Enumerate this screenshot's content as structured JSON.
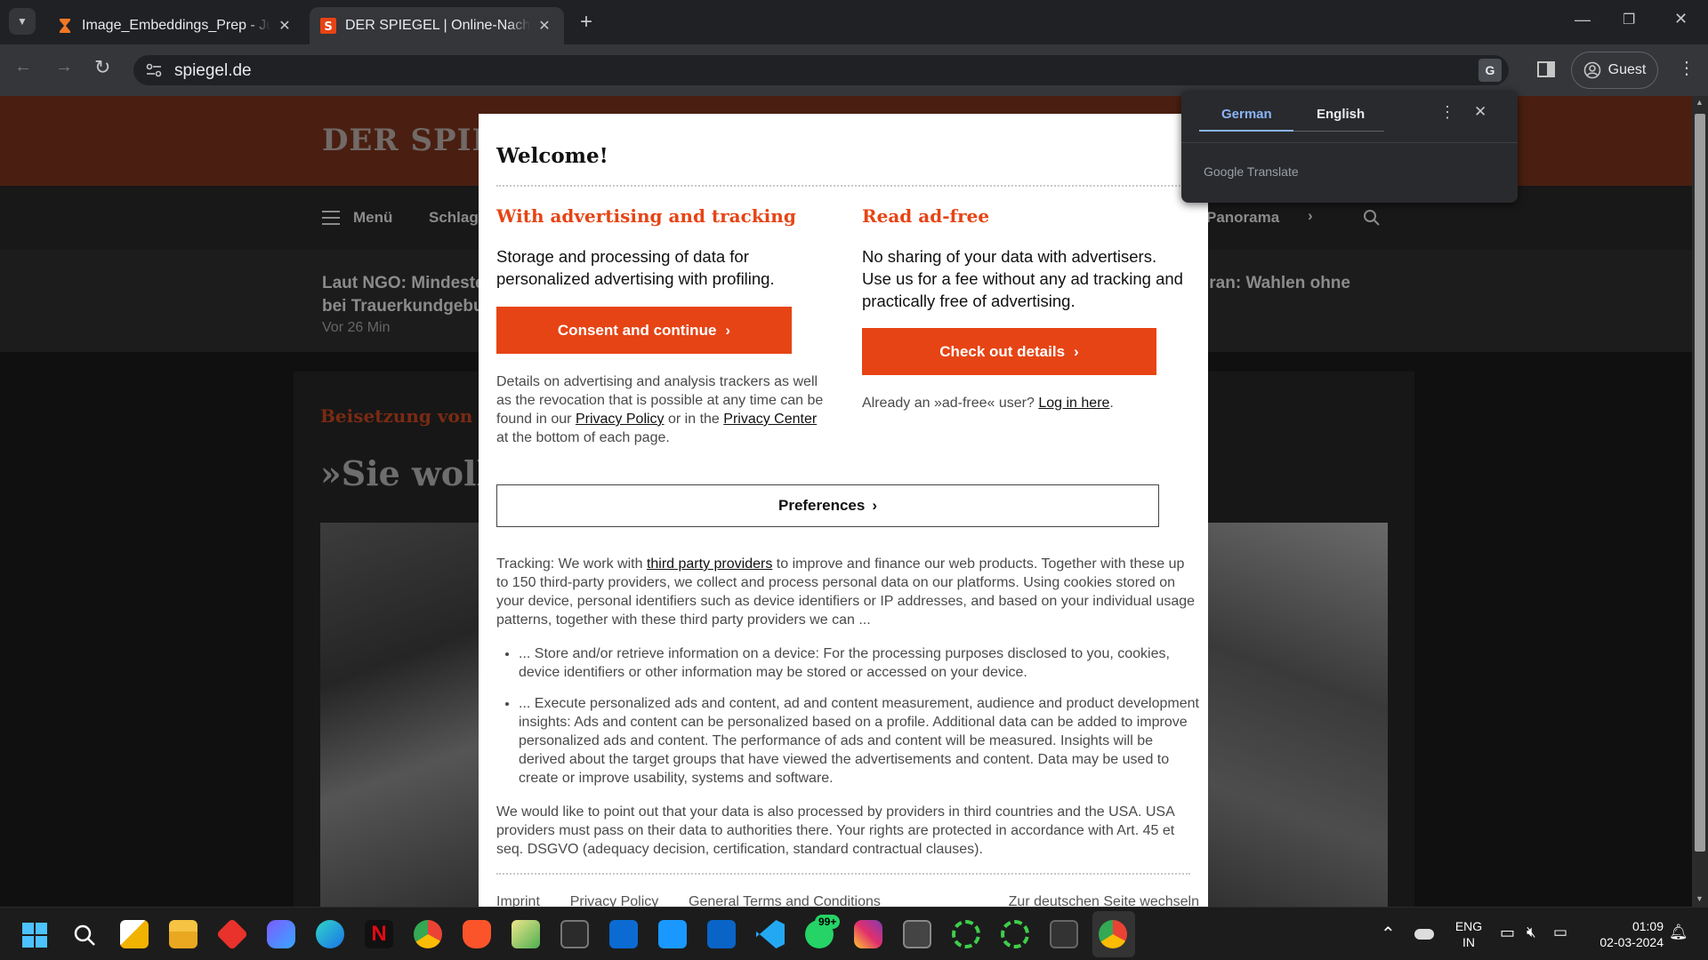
{
  "browser": {
    "tabs": [
      {
        "title": "Image_Embeddings_Prep - Jupyter",
        "active": false
      },
      {
        "title": "DER SPIEGEL | Online-Nachrichten",
        "active": true
      }
    ],
    "url": "spiegel.de",
    "profile": "Guest",
    "icons": [
      "back-icon",
      "forward-icon",
      "reload-icon",
      "site-info-icon",
      "translate-icon",
      "sidepanel-icon",
      "menu-icon"
    ]
  },
  "page": {
    "logo": "DER SPIEGEL",
    "nav": {
      "menu": "Menü",
      "item1": "Schlagzeilen",
      "item_right": "Panorama"
    },
    "ticker_left_1": "Laut NGO: Mindeste",
    "ticker_left_2": "bei Trauerkundgebu",
    "ticker_time": "Vor 26 Min",
    "ticker_right": "Iran: Wahlen ohne",
    "kicker": "Beisetzung von Kr",
    "headline": "»Sie wolle"
  },
  "modal": {
    "title": "Welcome!",
    "left": {
      "heading": "With advertising and tracking",
      "text": "Storage and processing of data for personalized advertising with profiling.",
      "button": "Consent and continue",
      "details_1": "Details on advertising and analysis trackers as well as the revocation that is possible at any time can be found in our",
      "privacy_policy": "Privacy Policy",
      "details_2": "or in the",
      "privacy_center": "Privacy Center",
      "details_3": "at the bottom of each page."
    },
    "right": {
      "heading": "Read ad-free",
      "text": "No sharing of your data with advertisers. Use us for a fee without any ad tracking and practically free of advertising.",
      "button": "Check out details",
      "already": "Already an »ad-free« user?",
      "login": "Log in here",
      "period": "."
    },
    "preferences": "Preferences",
    "tracking_1": "Tracking: We work with",
    "third_party": "third party providers",
    "tracking_2": "to improve and finance our web products. Together with these up to 150 third-party providers, we collect and process personal data on our platforms. Using cookies stored on your device, personal identifiers such as device identifiers or IP addresses, and based on your individual usage patterns, together with these third party providers we can ...",
    "bullets": [
      "... Store and/or retrieve information on a device: For the processing purposes disclosed to you, cookies, device identifiers or other information may be stored or accessed on your device.",
      "... Execute personalized ads and content, ad and content measurement, audience and product development insights: Ads and content can be personalized based on a profile. Additional data can be added to improve personalized ads and content. The performance of ads and content will be measured. Insights will be derived about the target groups that have viewed the advertisements and content. Data may be used to create or improve usability, systems and software."
    ],
    "third_countries": "We would like to point out that your data is also processed by providers in third countries and the USA. USA providers must pass on their data to authorities there. Your rights are protected in accordance with Art. 45 et seq. DSGVO (adequacy decision, certification, standard contractual clauses).",
    "footer": [
      "Imprint",
      "Privacy Policy",
      "General Terms and Conditions",
      "Zur deutschen Seite wechseln"
    ]
  },
  "translate_popup": {
    "tab_source": "German",
    "tab_target": "English",
    "branding": "Google Translate"
  },
  "taskbar": {
    "lang_1": "ENG",
    "lang_2": "IN",
    "time": "01:09",
    "date": "02-03-2024",
    "whatsapp_badge": "99+"
  },
  "colors": {
    "spiegel_red": "#e64415",
    "chrome_dark": "#202124",
    "chrome_toolbar": "#35363a"
  }
}
